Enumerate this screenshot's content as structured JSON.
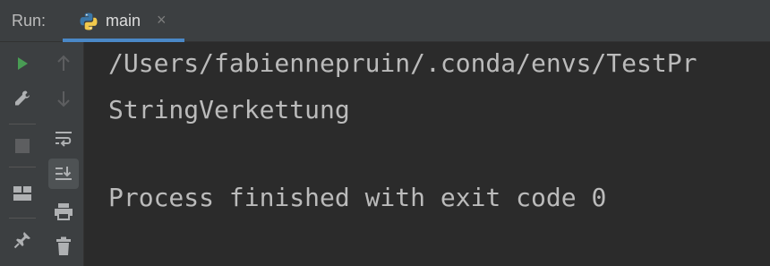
{
  "run_panel": {
    "label": "Run:",
    "tab": {
      "title": "main",
      "close": "×",
      "icon": "python-icon"
    }
  },
  "left_toolbar": [
    {
      "name": "run-button",
      "icon": "play-icon",
      "color": "#499c54"
    },
    {
      "name": "settings-button",
      "icon": "wrench-icon"
    },
    {
      "name": "stop-button",
      "icon": "stop-icon"
    },
    {
      "name": "layout-button",
      "icon": "layout-icon"
    },
    {
      "name": "pin-button",
      "icon": "pin-icon"
    }
  ],
  "console_toolbar": [
    {
      "name": "scroll-up-button",
      "icon": "arrow-up-icon"
    },
    {
      "name": "scroll-down-button",
      "icon": "arrow-down-icon"
    },
    {
      "name": "soft-wrap-button",
      "icon": "soft-wrap-icon"
    },
    {
      "name": "scroll-to-end-button",
      "icon": "scroll-to-end-icon",
      "active": true
    },
    {
      "name": "print-button",
      "icon": "print-icon"
    },
    {
      "name": "clear-button",
      "icon": "trash-icon"
    }
  ],
  "console": {
    "lines": [
      "/Users/fabiennepruin/.conda/envs/TestPr",
      "StringVerkettung",
      "",
      "Process finished with exit code 0"
    ]
  },
  "colors": {
    "background": "#2b2b2b",
    "toolbar": "#3c3f41",
    "text": "#bbbbbb",
    "run_green": "#499c54",
    "tab_underline": "#4a88c7"
  }
}
